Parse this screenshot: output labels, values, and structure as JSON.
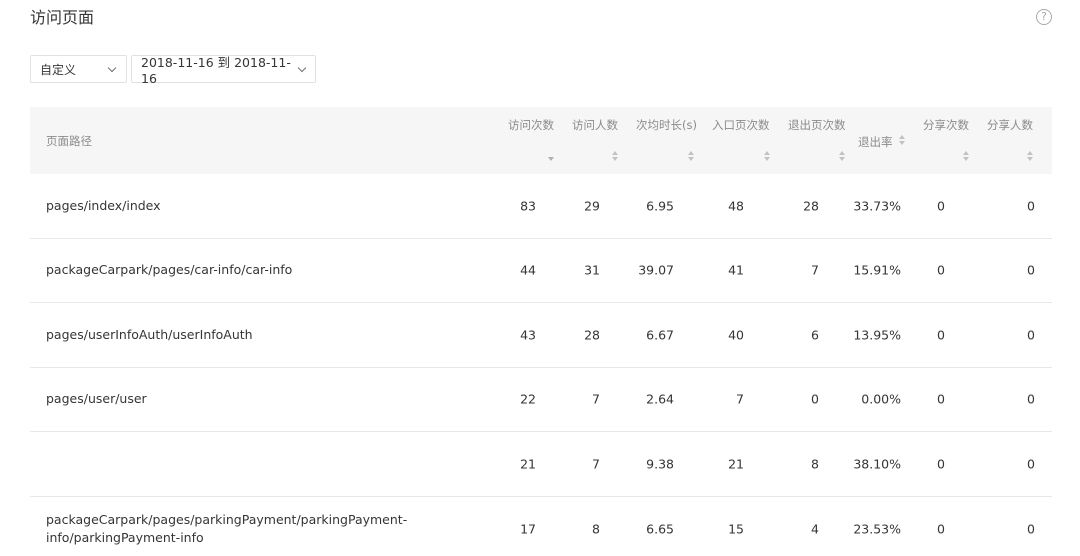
{
  "page": {
    "title": "访问页面",
    "help_icon": "?"
  },
  "filters": {
    "range_select": "自定义",
    "date_range": "2018-11-16 到 2018-11-16"
  },
  "table": {
    "columns": [
      "页面路径",
      "访问次数",
      "访问人数",
      "次均时长(s)",
      "入口页次数",
      "退出页次数",
      "退出率",
      "分享次数",
      "分享人数"
    ],
    "rows": [
      {
        "path": "pages/index/index",
        "visits": "83",
        "visitors": "29",
        "avg_duration": "6.95",
        "entry": "48",
        "exit": "28",
        "exit_rate": "33.73%",
        "shares": "0",
        "sharers": "0"
      },
      {
        "path": "packageCarpark/pages/car-info/car-info",
        "visits": "44",
        "visitors": "31",
        "avg_duration": "39.07",
        "entry": "41",
        "exit": "7",
        "exit_rate": "15.91%",
        "shares": "0",
        "sharers": "0"
      },
      {
        "path": "pages/userInfoAuth/userInfoAuth",
        "visits": "43",
        "visitors": "28",
        "avg_duration": "6.67",
        "entry": "40",
        "exit": "6",
        "exit_rate": "13.95%",
        "shares": "0",
        "sharers": "0"
      },
      {
        "path": "pages/user/user",
        "visits": "22",
        "visitors": "7",
        "avg_duration": "2.64",
        "entry": "7",
        "exit": "0",
        "exit_rate": "0.00%",
        "shares": "0",
        "sharers": "0"
      },
      {
        "path": "",
        "visits": "21",
        "visitors": "7",
        "avg_duration": "9.38",
        "entry": "21",
        "exit": "8",
        "exit_rate": "38.10%",
        "shares": "0",
        "sharers": "0"
      },
      {
        "path": "packageCarpark/pages/parkingPayment/parkingPayment-info/parkingPayment-info",
        "visits": "17",
        "visitors": "8",
        "avg_duration": "6.65",
        "entry": "15",
        "exit": "4",
        "exit_rate": "23.53%",
        "shares": "0",
        "sharers": "0"
      }
    ]
  }
}
